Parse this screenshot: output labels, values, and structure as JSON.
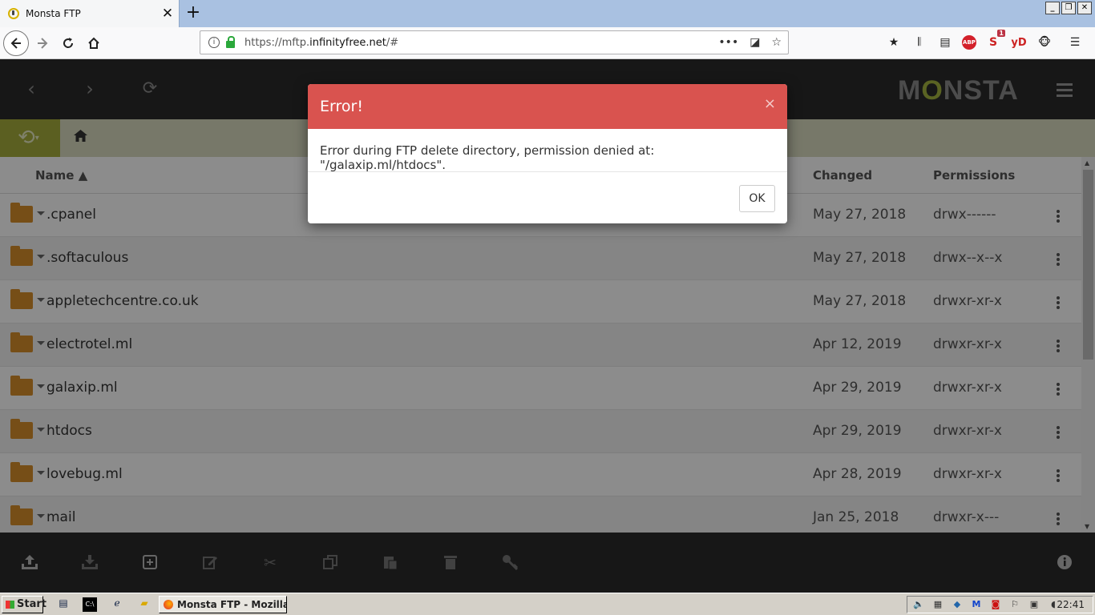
{
  "browser": {
    "tab_title": "Monsta FTP",
    "url_prefix": "https://mftp.",
    "url_domain": "infinityfree.net",
    "url_suffix": "/#",
    "abp_label": "ABP",
    "ext_badge": "1",
    "yd_label": "yD"
  },
  "app": {
    "logo_pre": "M",
    "logo_o": "O",
    "logo_post": "NSTA",
    "columns": {
      "name": "Name ▲",
      "changed": "Changed",
      "permissions": "Permissions"
    },
    "rows": [
      {
        "name": ".cpanel",
        "changed": "May 27, 2018",
        "permissions": "drwx------"
      },
      {
        "name": ".softaculous",
        "changed": "May 27, 2018",
        "permissions": "drwx--x--x"
      },
      {
        "name": "appletechcentre.co.uk",
        "changed": "May 27, 2018",
        "permissions": "drwxr-xr-x"
      },
      {
        "name": "electrotel.ml",
        "changed": "Apr 12, 2019",
        "permissions": "drwxr-xr-x"
      },
      {
        "name": "galaxip.ml",
        "changed": "Apr 29, 2019",
        "permissions": "drwxr-xr-x"
      },
      {
        "name": "htdocs",
        "changed": "Apr 29, 2019",
        "permissions": "drwxr-xr-x"
      },
      {
        "name": "lovebug.ml",
        "changed": "Apr 28, 2019",
        "permissions": "drwxr-xr-x"
      },
      {
        "name": "mail",
        "changed": "Jan 25, 2018",
        "permissions": "drwxr-x---"
      }
    ]
  },
  "modal": {
    "title": "Error!",
    "close": "×",
    "message": "Error during FTP delete directory, permission denied at: \"/galaxip.ml/htdocs\".",
    "ok_label": "OK"
  },
  "taskbar": {
    "start_label": "Start",
    "task_item": "Monsta FTP - Mozilla F...",
    "clock": "22:41"
  }
}
